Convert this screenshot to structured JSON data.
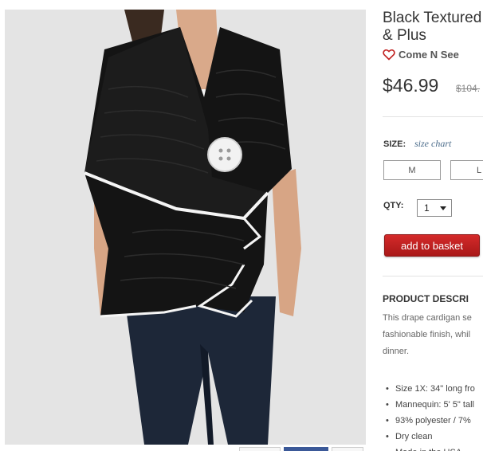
{
  "product": {
    "title_line1": "Black Textured",
    "title_line2": "& Plus",
    "brand": "Come N See",
    "price": "$46.99",
    "old_price": "$104."
  },
  "size": {
    "label": "SIZE:",
    "chart_link": "size chart",
    "options": [
      "M",
      "L"
    ]
  },
  "quantity": {
    "label": "QTY:",
    "value": "1"
  },
  "add_to_basket_label": "add to basket",
  "description": {
    "heading": "PRODUCT DESCRI",
    "lines": [
      "This drape cardigan se",
      "fashionable finish, whil",
      "dinner."
    ],
    "bullets": [
      "Size 1X: 34\" long fro",
      "Mannequin: 5' 5\" tall",
      "93% polyester / 7%",
      "Dry clean",
      "Made in the USA"
    ]
  },
  "icons": {
    "heart": "heart-outline-icon",
    "select_arrow": "chevron-down-icon"
  },
  "colors": {
    "accent_red": "#c0201f",
    "brand_heart": "#c0201f",
    "link_blue": "#4a6b8a"
  }
}
